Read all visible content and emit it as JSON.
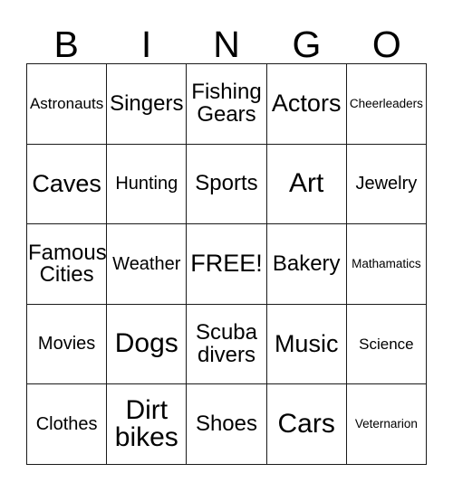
{
  "header": {
    "letters": [
      "B",
      "I",
      "N",
      "G",
      "O"
    ]
  },
  "grid": {
    "rows": [
      [
        {
          "text": "Astronauts",
          "size": "xs"
        },
        {
          "text": "Singers",
          "size": "md"
        },
        {
          "text": "Fishing\nGears",
          "size": "md"
        },
        {
          "text": "Actors",
          "size": "lg"
        },
        {
          "text": "Cheerleaders",
          "size": "xxs"
        }
      ],
      [
        {
          "text": "Caves",
          "size": "lg"
        },
        {
          "text": "Hunting",
          "size": "sm"
        },
        {
          "text": "Sports",
          "size": "md"
        },
        {
          "text": "Art",
          "size": "xl"
        },
        {
          "text": "Jewelry",
          "size": "sm"
        }
      ],
      [
        {
          "text": "Famous\nCities",
          "size": "md"
        },
        {
          "text": "Weather",
          "size": "sm"
        },
        {
          "text": "FREE!",
          "size": "lg"
        },
        {
          "text": "Bakery",
          "size": "md"
        },
        {
          "text": "Mathamatics",
          "size": "xxs"
        }
      ],
      [
        {
          "text": "Movies",
          "size": "sm"
        },
        {
          "text": "Dogs",
          "size": "xl"
        },
        {
          "text": "Scuba\ndivers",
          "size": "md"
        },
        {
          "text": "Music",
          "size": "lg"
        },
        {
          "text": "Science",
          "size": "xs"
        }
      ],
      [
        {
          "text": "Clothes",
          "size": "sm"
        },
        {
          "text": "Dirt\nbikes",
          "size": "xl"
        },
        {
          "text": "Shoes",
          "size": "md"
        },
        {
          "text": "Cars",
          "size": "xl"
        },
        {
          "text": "Veternarion",
          "size": "xxs"
        }
      ]
    ]
  },
  "colors": {
    "background": "#ffffff",
    "border": "#1a1a1a",
    "text": "#000000"
  }
}
